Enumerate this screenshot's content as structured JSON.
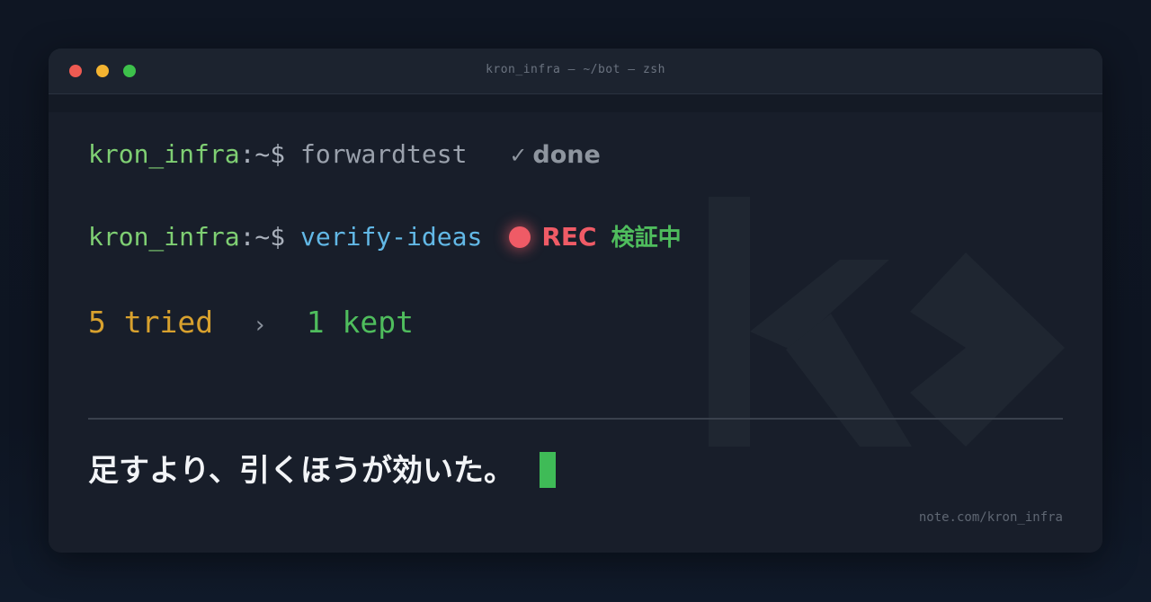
{
  "window": {
    "title": "kron_infra — ~/bot — zsh",
    "controls": {
      "close_color": "#ee5a52",
      "minimize_color": "#f4b431",
      "maximize_color": "#3dc14b"
    }
  },
  "terminal": {
    "line1": {
      "user": "kron_infra",
      "path": ":~$",
      "command": "forwardtest",
      "check": "✓",
      "status": "done"
    },
    "line2": {
      "user": "kron_infra",
      "path": ":~$",
      "command": "verify-ideas",
      "rec_label": "REC",
      "rec_status": "検証中"
    },
    "line3": {
      "tried": "5 tried",
      "arrow": "›",
      "kept": "1 kept"
    }
  },
  "tagline": "足すより、引くほうが効いた。",
  "credit": "note.com/kron_infra",
  "icons": {
    "watermark": "kron-logo-icon",
    "rec": "record-dot-icon",
    "cursor": "block-cursor-icon"
  },
  "colors": {
    "prompt_user": "#7fcf73",
    "command_highlight": "#62b8e6",
    "rec": "#ef5b66",
    "tried": "#d8a12e",
    "kept": "#4fbd5d",
    "cursor": "#3fbb57"
  }
}
